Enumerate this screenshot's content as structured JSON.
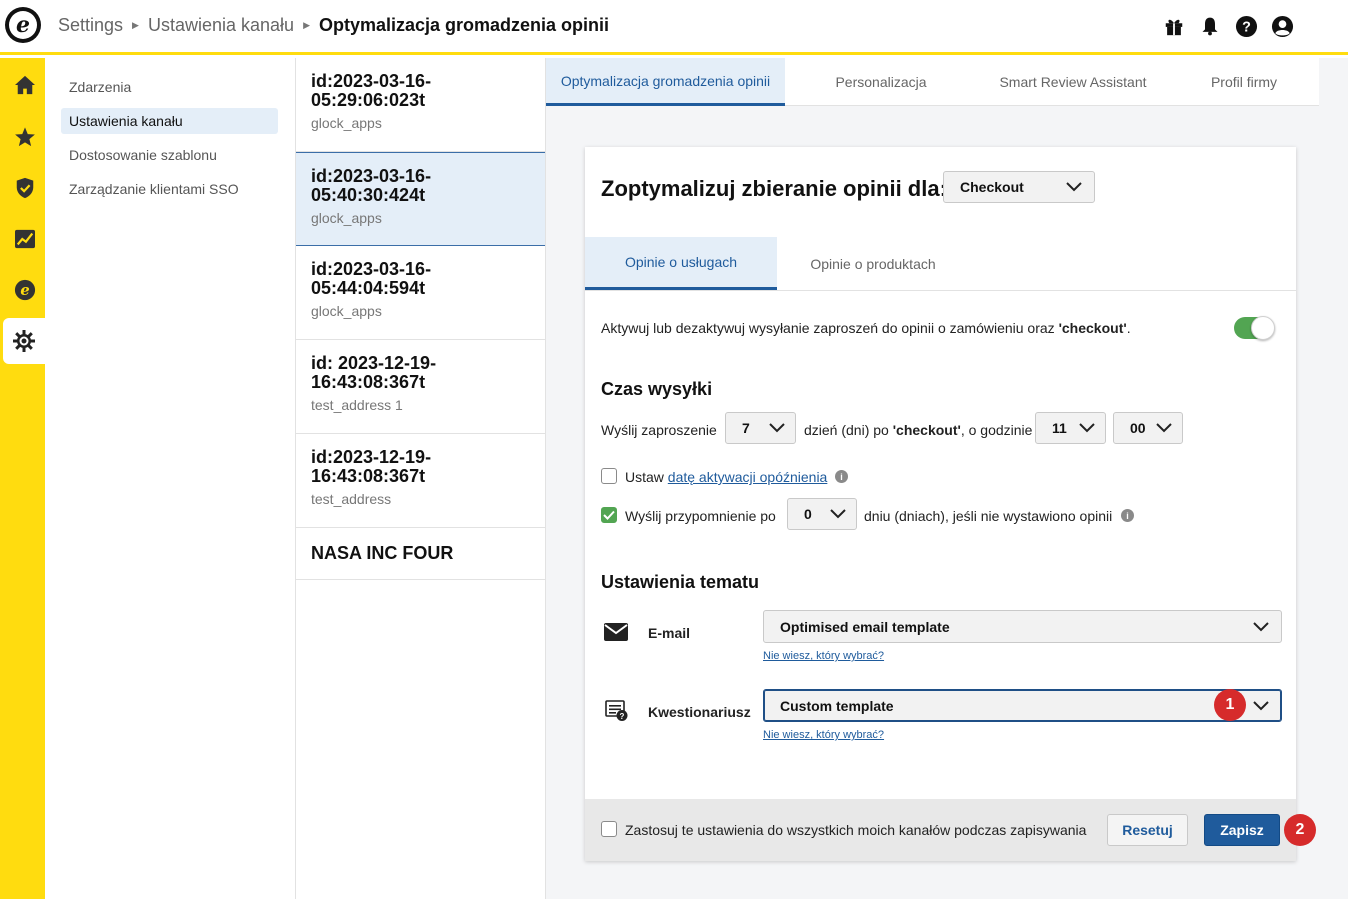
{
  "header": {
    "logo_letter": "e",
    "breadcrumb": [
      "Settings",
      "Ustawienia kanału",
      "Optymalizacja gromadzenia opinii"
    ],
    "icons": [
      "gift-icon",
      "bell-icon",
      "help-icon",
      "user-icon"
    ]
  },
  "rail": {
    "items": [
      "home-icon",
      "star-icon",
      "shield-icon",
      "chart-icon",
      "trustedshops-e-icon",
      "gear-icon"
    ],
    "active": "gear-icon"
  },
  "submenu": {
    "items": [
      {
        "label": "Zdarzenia"
      },
      {
        "label": "Ustawienia kanału"
      },
      {
        "label": "Dostosowanie szablonu"
      },
      {
        "label": "Zarządzanie klientami SSO"
      }
    ],
    "active_index": 1
  },
  "channels": [
    {
      "id": "id:2023-03-16-05:29:06:023t",
      "sub": "glock_apps"
    },
    {
      "id": "id:2023-03-16-05:40:30:424t",
      "sub": "glock_apps"
    },
    {
      "id": "id:2023-03-16-05:44:04:594t",
      "sub": "glock_apps"
    },
    {
      "id": "id: 2023-12-19-16:43:08:367t",
      "sub": "test_address 1"
    },
    {
      "id": "id:2023-12-19-16:43:08:367t",
      "sub": "test_address"
    },
    {
      "id": "NASA INC FOUR",
      "sub": ""
    }
  ],
  "tabs": [
    {
      "label": "Optymalizacja gromadzenia opinii"
    },
    {
      "label": "Personalizacja"
    },
    {
      "label": "Smart Review Assistant"
    },
    {
      "label": "Profil firmy"
    }
  ],
  "card": {
    "title": "Zoptymalizuj zbieranie opinii dla:",
    "channel_select": "Checkout",
    "subtabs": [
      "Opinie o usługach",
      "Opinie o produktach"
    ],
    "toggle_text_pre": "Aktywuj lub dezaktywuj wysyłanie zaproszeń do opinii o zamówieniu oraz ",
    "toggle_text_bold": "'checkout'",
    "toggle_text_post": ".",
    "toggle_on": true,
    "send_time_heading": "Czas wysyłki",
    "send_label": "Wyślij zaproszenie",
    "days_value": "7",
    "days_text_pre": "dzień (dni) po ",
    "days_text_bold": "'checkout'",
    "days_text_post": ", o godzinie",
    "hour_value": "11",
    "minute_value": "00",
    "delay_label_pre": "Ustaw ",
    "delay_label_link": "datę aktywacji opóźnienia",
    "delay_checked": false,
    "reminder_label": "Wyślij przypomnienie po",
    "reminder_checked": true,
    "reminder_value": "0",
    "reminder_suffix": "dniu (dniach), jeśli nie wystawiono opinii",
    "theme_heading": "Ustawienia tematu",
    "email_label": "E-mail",
    "email_template": "Optimised email template",
    "help_link": "Nie wiesz, który wybrać?",
    "questionnaire_label": "Kwestionariusz",
    "questionnaire_template": "Custom template",
    "apply_all_label": "Zastosuj te ustawienia do wszystkich moich kanałów podczas zapisywania",
    "reset_label": "Resetuj",
    "save_label": "Zapisz"
  },
  "badges": [
    "1",
    "2"
  ],
  "colors": {
    "brand_yellow": "#ffdc0f",
    "primary_blue": "#1f5b9c",
    "toggle_green": "#52a552",
    "badge_red": "#d62b2b"
  }
}
